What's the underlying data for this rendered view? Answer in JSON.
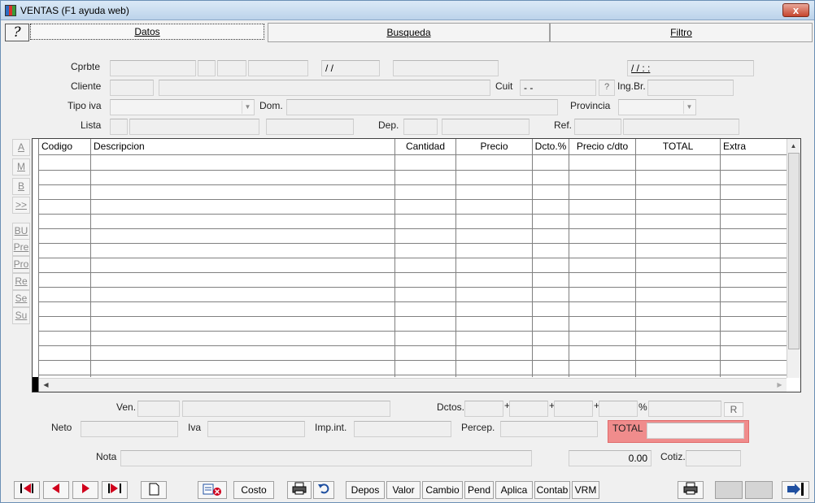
{
  "window": {
    "title": "VENTAS (F1 ayuda web)",
    "close_label": "x"
  },
  "tabs": {
    "help": "?",
    "datos": "Datos",
    "busqueda": "Busqueda",
    "filtro": "Filtro"
  },
  "header": {
    "cprbte_label": "Cprbte",
    "cprbte_date": "/ /",
    "datetime": "/ /      : :",
    "cliente_label": "Cliente",
    "cuit_label": "Cuit",
    "cuit_value": "-        -",
    "cuit_help": "?",
    "ingbr_label": "Ing.Br.",
    "tipoiva_label": "Tipo iva",
    "dom_label": "Dom.",
    "provincia_label": "Provincia",
    "lista_label": "Lista",
    "dep_label": "Dep.",
    "ref_label": "Ref."
  },
  "side_buttons": [
    "A",
    "M",
    "B",
    ">>",
    "BU",
    "Pre",
    "Pro",
    "Re",
    "Se",
    "Su"
  ],
  "grid": {
    "columns": [
      "Codigo",
      "Descripcion",
      "Cantidad",
      "Precio",
      "Dcto.%",
      "Precio c/dto",
      "TOTAL",
      "Extra"
    ]
  },
  "footer": {
    "ven_label": "Ven.",
    "dctos_label": "Dctos.",
    "plus": "+",
    "percent": "%",
    "r_button": "R",
    "neto_label": "Neto",
    "iva_label": "Iva",
    "impint_label": "Imp.int.",
    "percep_label": "Percep.",
    "total_label": "TOTAL",
    "nota_label": "Nota",
    "amount": "0.00",
    "cotiz_label": "Cotiz."
  },
  "toolbar": {
    "costo": "Costo",
    "depos": "Depos",
    "valor": "Valor",
    "cambio": "Cambio",
    "pend": "Pend",
    "aplica": "Aplica",
    "contab": "Contab",
    "vrm": "VRM"
  },
  "colors": {
    "total_bg": "#f08c8c",
    "accent": "#1f4fa0",
    "nav_red": "#d0001c"
  }
}
